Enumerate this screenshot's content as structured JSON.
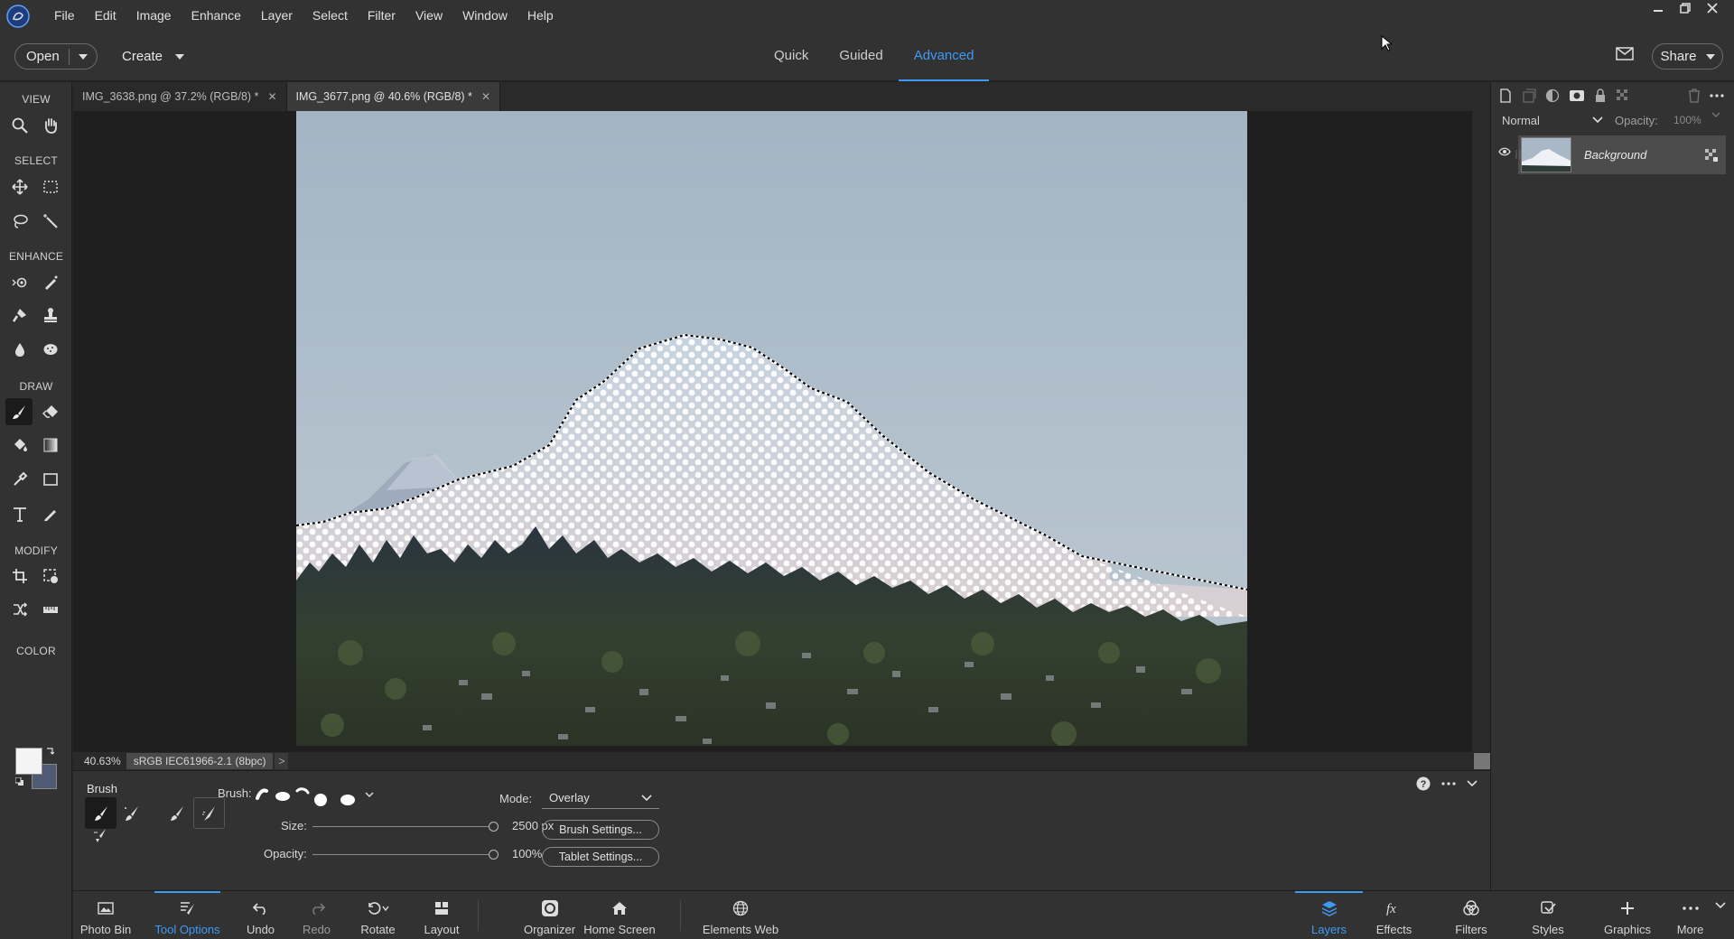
{
  "menu": [
    "File",
    "Edit",
    "Image",
    "Enhance",
    "Layer",
    "Select",
    "Filter",
    "View",
    "Window",
    "Help"
  ],
  "header": {
    "open_label": "Open",
    "create_label": "Create",
    "modes": [
      "Quick",
      "Guided",
      "Advanced"
    ],
    "active_mode": "Advanced",
    "share_label": "Share"
  },
  "toolbox": {
    "sections": [
      "VIEW",
      "SELECT",
      "ENHANCE",
      "DRAW",
      "MODIFY",
      "COLOR"
    ],
    "active_tool": "brush",
    "foreground_color": "#f4f4f4",
    "background_color": "#4e5b72"
  },
  "document_tabs": [
    {
      "label": "IMG_3638.png @ 37.2% (RGB/8) *",
      "active": false
    },
    {
      "label": "IMG_3677.png @ 40.6% (RGB/8) *",
      "active": true
    }
  ],
  "status": {
    "zoom": "40.63%",
    "color_profile": "sRGB IEC61966-2.1 (8bpc)",
    "arrow": ">"
  },
  "tool_options": {
    "title": "Brush",
    "brush_label": "Brush:",
    "size_label": "Size:",
    "size_value": "2500 px",
    "size_fraction": 1.0,
    "opacity_label": "Opacity:",
    "opacity_value": "100%",
    "opacity_fraction": 1.0,
    "mode_label": "Mode:",
    "mode_value": "Overlay",
    "brush_settings_label": "Brush Settings...",
    "tablet_settings_label": "Tablet Settings..."
  },
  "layers_panel": {
    "blend_mode": "Normal",
    "opacity_label": "Opacity:",
    "opacity_value": "100%",
    "layer_name": "Background"
  },
  "bottom_bar": {
    "left": [
      {
        "label": "Photo Bin",
        "icon": "photo-bin-icon"
      },
      {
        "label": "Tool Options",
        "icon": "tool-options-icon",
        "active": true
      },
      {
        "label": "Undo",
        "icon": "undo-icon"
      },
      {
        "label": "Redo",
        "icon": "redo-icon"
      },
      {
        "label": "Rotate",
        "icon": "rotate-icon"
      },
      {
        "label": "Layout",
        "icon": "layout-icon"
      },
      {
        "label": "Organizer",
        "icon": "organizer-icon"
      },
      {
        "label": "Home Screen",
        "icon": "home-icon"
      },
      {
        "label": "Elements Web",
        "icon": "globe-icon"
      }
    ],
    "right": [
      {
        "label": "Layers",
        "icon": "layers-icon",
        "active": true
      },
      {
        "label": "Effects",
        "icon": "fx-icon"
      },
      {
        "label": "Filters",
        "icon": "filters-icon"
      },
      {
        "label": "Styles",
        "icon": "styles-icon"
      },
      {
        "label": "Graphics",
        "icon": "plus-icon"
      },
      {
        "label": "More",
        "icon": "more-icon"
      }
    ]
  },
  "colors": {
    "accent": "#3d9bf5",
    "panel": "#323232",
    "canvas_bg": "#1f1f1f"
  }
}
